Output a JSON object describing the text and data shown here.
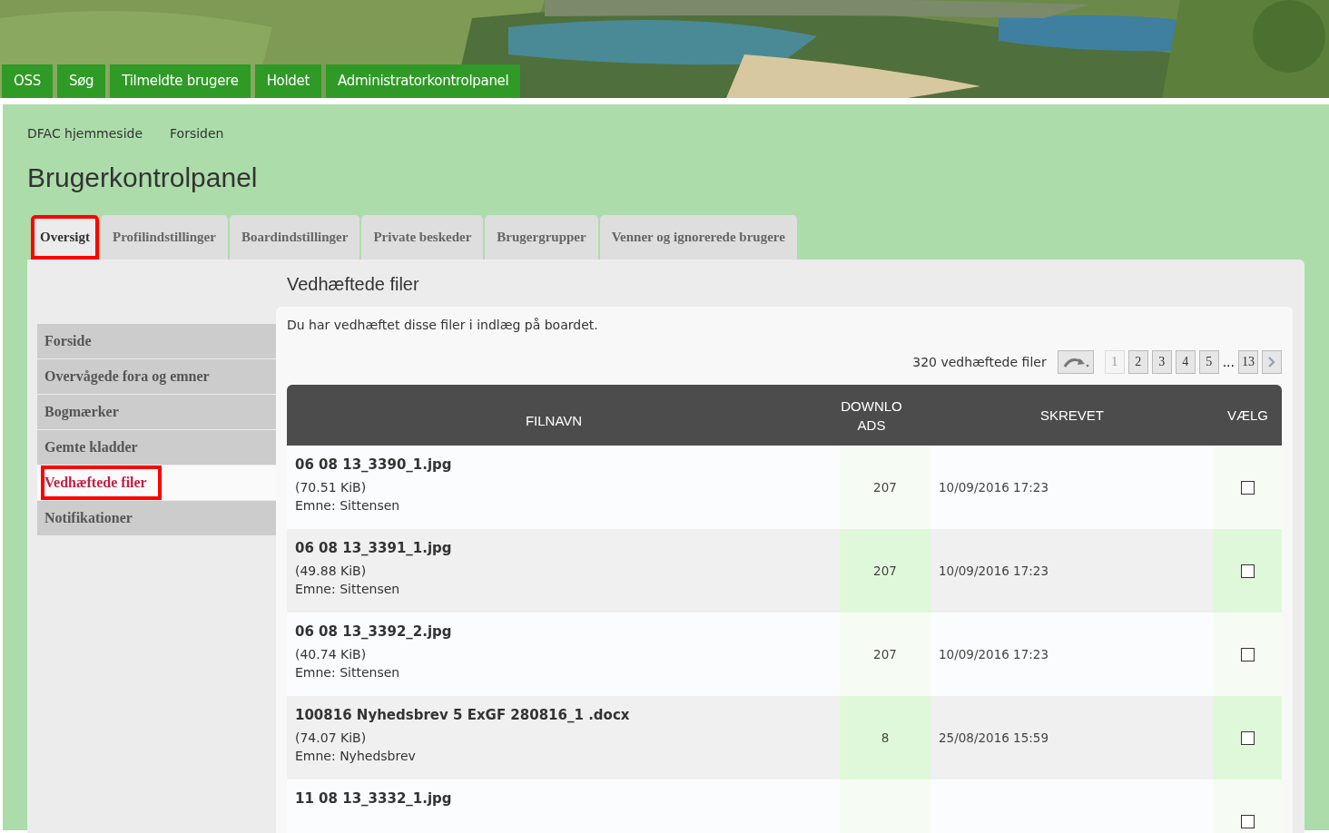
{
  "nav": [
    {
      "label": "OSS"
    },
    {
      "label": "Søg"
    },
    {
      "label": "Tilmeldte brugere"
    },
    {
      "label": "Holdet"
    },
    {
      "label": "Administratorkontrolpanel"
    }
  ],
  "breadcrumbs": [
    "DFAC hjemmeside",
    "Forsiden"
  ],
  "page_title": "Brugerkontrolpanel",
  "tabs": [
    {
      "label": "Oversigt",
      "selected": true,
      "highlighted": true
    },
    {
      "label": "Profilindstillinger",
      "selected": false,
      "highlighted": false
    },
    {
      "label": "Boardindstillinger",
      "selected": false,
      "highlighted": false
    },
    {
      "label": "Private beskeder",
      "selected": false,
      "highlighted": false
    },
    {
      "label": "Brugergrupper",
      "selected": false,
      "highlighted": false
    },
    {
      "label": "Venner og ignorerede brugere",
      "selected": false,
      "highlighted": false
    }
  ],
  "sidebar": {
    "items": [
      {
        "label": "Forside",
        "selected": false,
        "highlighted": false
      },
      {
        "label": "Overvågede fora og emner",
        "selected": false,
        "highlighted": false
      },
      {
        "label": "Bogmærker",
        "selected": false,
        "highlighted": false
      },
      {
        "label": "Gemte kladder",
        "selected": false,
        "highlighted": false
      },
      {
        "label": "Vedhæftede filer",
        "selected": true,
        "highlighted": true
      },
      {
        "label": "Notifikationer",
        "selected": false,
        "highlighted": false
      }
    ]
  },
  "section_title": "Vedhæftede filer",
  "intro": "Du har vedhæftet disse filer i indlæg på boardet.",
  "pagination": {
    "count": "320 vedhæftede filer",
    "pages": [
      {
        "label": "1",
        "selected": true
      },
      {
        "label": "2",
        "selected": false
      },
      {
        "label": "3",
        "selected": false
      },
      {
        "label": "4",
        "selected": false
      },
      {
        "label": "5",
        "selected": false
      },
      {
        "label": "13",
        "selected": false
      }
    ],
    "ellipsis": "..."
  },
  "table": {
    "columns": [
      "FILNAVN",
      "DOWNLOADS",
      "SKREVET",
      "VÆLG"
    ],
    "rows": [
      {
        "filename": "06 08 13_3390_1.jpg",
        "size": "(70.51 KiB)",
        "topic": "Emne: Sittensen",
        "downloads": "207",
        "posted": "10/09/2016 17:23",
        "checked": false
      },
      {
        "filename": "06 08 13_3391_1.jpg",
        "size": "(49.88 KiB)",
        "topic": "Emne: Sittensen",
        "downloads": "207",
        "posted": "10/09/2016 17:23",
        "checked": false
      },
      {
        "filename": "06 08 13_3392_2.jpg",
        "size": "(40.74 KiB)",
        "topic": "Emne: Sittensen",
        "downloads": "207",
        "posted": "10/09/2016 17:23",
        "checked": false
      },
      {
        "filename": "100816 Nyhedsbrev 5 ExGF 280816_1 .docx",
        "size": "(74.07 KiB)",
        "topic": "Emne: Nyhedsbrev",
        "downloads": "8",
        "posted": "25/08/2016 15:59",
        "checked": false
      },
      {
        "filename": "11 08 13_3332_1.jpg",
        "checked": false
      }
    ]
  }
}
